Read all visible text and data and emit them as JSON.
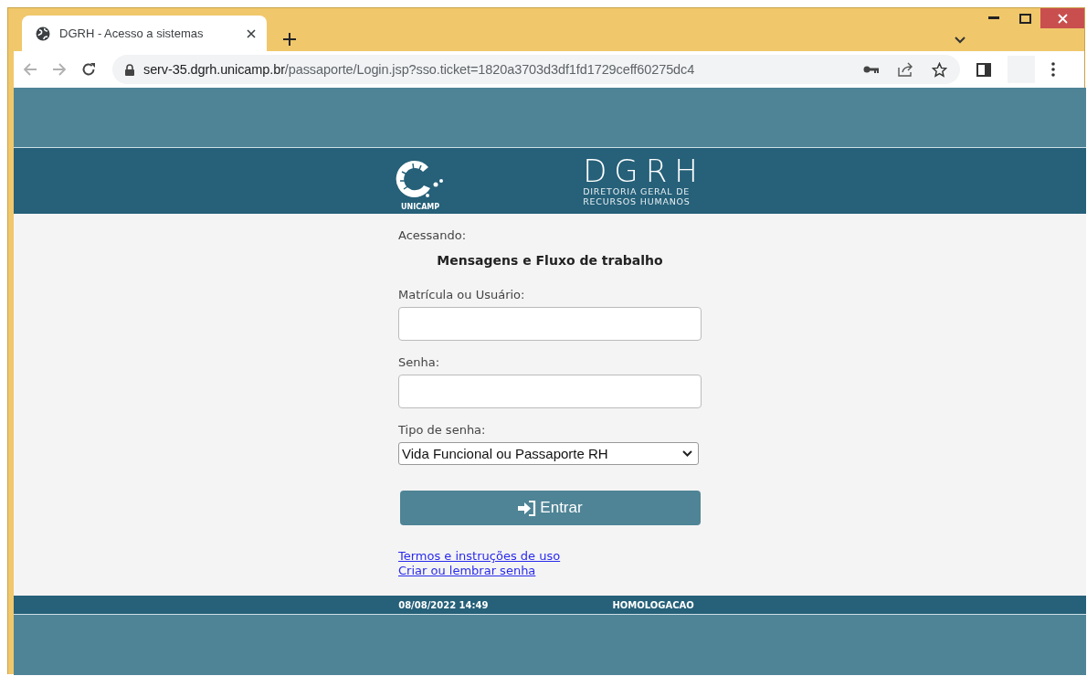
{
  "browser": {
    "tab_title": "DGRH - Acesso a sistemas",
    "url_host": "serv-35.dgrh.unicamp.br",
    "url_path": "/passaporte/Login.jsp?sso.ticket=1820a3703d3df1fd1729ceff60275dc4"
  },
  "header": {
    "logo_label": "UNICAMP",
    "brand": "DGRH",
    "brand_subtitle_1": "DIRETORIA GERAL DE",
    "brand_subtitle_2": "RECURSOS HUMANOS"
  },
  "login": {
    "accessing_label": "Acessando:",
    "system_name": "Mensagens e Fluxo de trabalho",
    "fields": [
      {
        "kind": "text",
        "label": "Matrícula ou Usuário:"
      },
      {
        "kind": "password",
        "label": "Senha:"
      },
      {
        "kind": "select",
        "label": "Tipo de senha:",
        "value": "Vida Funcional ou Passaporte RH"
      }
    ],
    "submit": "Entrar",
    "links": [
      "Termos e instruções de uso",
      "Criar ou lembrar senha"
    ]
  },
  "footer": {
    "timestamp": "08/08/2022 14:49",
    "environment": "HOMOLOGACAO"
  }
}
